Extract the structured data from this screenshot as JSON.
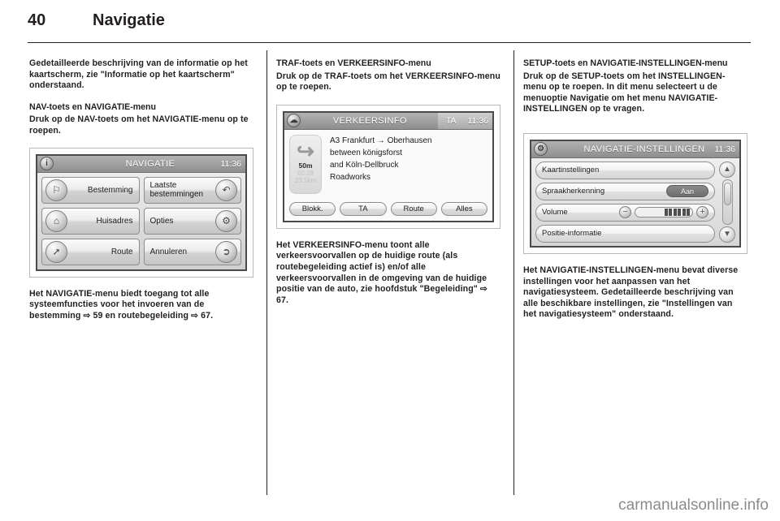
{
  "header": {
    "page_number": "40",
    "title": "Navigatie"
  },
  "footer": {
    "watermark": "carmanualsonline.info"
  },
  "columns": {
    "col1": {
      "intro": "Gedetailleerde beschrijving van de informatie op het kaartscherm, zie \"Informatie op het kaartscherm\" onderstaand.",
      "heading": "NAV-toets en NAVIGATIE-menu",
      "para": "Druk op de NAV-toets om het NAVIGATIE-menu op te roepen.",
      "after": "Het NAVIGATIE-menu biedt toegang tot alle systeemfuncties voor het invoeren van de bestemming ⇨ 59 en routebegeleiding ⇨ 67."
    },
    "col2": {
      "heading": "TRAF-toets en VERKEERSINFO-menu",
      "para": "Druk op de TRAF-toets om het VERKEERSINFO-menu op te roepen.",
      "after": "Het VERKEERSINFO-menu toont alle verkeersvoorvallen op de huidige route (als routebegeleiding actief is) en/of alle verkeersvoorvallen in de omgeving van de huidige positie van de auto, zie hoofdstuk \"Begeleiding\" ⇨ 67."
    },
    "col3": {
      "heading": "SETUP-toets en NAVIGATIE-INSTELLINGEN-menu",
      "para": "Druk op de SETUP-toets om het INSTELLINGEN-menu op te roepen. In dit menu selecteert u de menuoptie Navigatie om het menu NAVIGATIE-INSTELLINGEN op te vragen.",
      "after": "Het NAVIGATIE-INSTELLINGEN-menu bevat diverse instellingen voor het aanpassen van het navigatiesysteem. Gedetailleerde beschrijving van alle beschikbare instellingen, zie \"Instellingen van het navigatiesysteem\" onderstaand."
    }
  },
  "nav_screen": {
    "title": "NAVIGATIE",
    "clock": "11:36",
    "title_icon": "info-icon",
    "buttons": [
      {
        "label": "Bestemming",
        "icon": "flag-icon",
        "side": "left"
      },
      {
        "label": "Laatste bestemmingen",
        "icon": "history-flag-icon",
        "side": "right"
      },
      {
        "label": "Huisadres",
        "icon": "home-icon",
        "side": "left"
      },
      {
        "label": "Opties",
        "icon": "gear-icon",
        "side": "right"
      },
      {
        "label": "Route",
        "icon": "signpost-icon",
        "side": "left"
      },
      {
        "label": "Annuleren",
        "icon": "cancel-route-icon",
        "side": "right"
      }
    ]
  },
  "traffic_screen": {
    "title": "VERKEERSINFO",
    "ta_label": "TA",
    "clock": "11:36",
    "title_icon": "traffic-cloud-icon",
    "maneuver": {
      "arrow_icon": "turn-right-icon",
      "distance": "50m",
      "eta": "00:28",
      "remaining": "23.5km"
    },
    "lines": [
      "A3 Frankfurt → Oberhausen",
      "between königsforst",
      "and Köln-Dellbruck",
      "Roadworks"
    ],
    "buttons": [
      "Blokk.",
      "TA",
      "Route",
      "Alles"
    ]
  },
  "settings_screen": {
    "title": "NAVIGATIE-INSTELLINGEN",
    "clock": "11:36",
    "title_icon": "gear-icon",
    "rows": [
      {
        "label": "Kaartinstellingen",
        "control": "none"
      },
      {
        "label": "Spraakherkenning",
        "control": "toggle",
        "value": "Aan"
      },
      {
        "label": "Volume",
        "control": "volume",
        "minus": "−",
        "plus": "+",
        "level": 6,
        "segments": 6
      },
      {
        "label": "Positie-informatie",
        "control": "none"
      }
    ],
    "scroll": {
      "up_icon": "chevron-up-icon",
      "down_icon": "chevron-down-icon"
    }
  }
}
